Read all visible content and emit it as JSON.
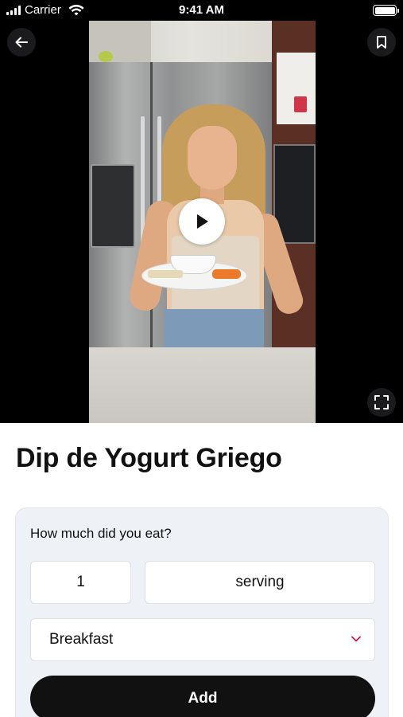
{
  "status_bar": {
    "carrier": "Carrier",
    "time": "9:41 AM",
    "icons": [
      "signal-icon",
      "wifi-icon",
      "battery-icon"
    ]
  },
  "video": {
    "icons": {
      "back": "arrow-left-icon",
      "bookmark": "bookmark-icon",
      "play": "play-icon",
      "fullscreen": "fullscreen-icon"
    }
  },
  "recipe": {
    "title": "Dip de Yogurt Griego"
  },
  "log_form": {
    "question": "How much did you eat?",
    "quantity": "1",
    "unit": "serving",
    "meal": "Breakfast",
    "add_label": "Add"
  },
  "colors": {
    "accent": "#c2185b",
    "button": "#111111",
    "card_bg": "#eef1f5"
  }
}
